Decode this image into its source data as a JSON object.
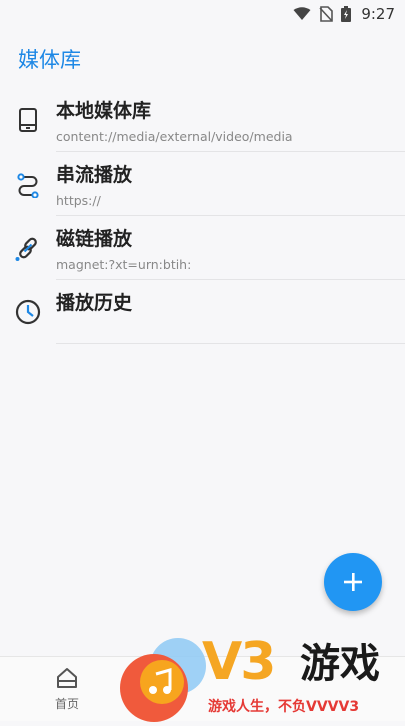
{
  "status_bar": {
    "time": "9:27"
  },
  "app_title": "媒体库",
  "items": [
    {
      "title": "本地媒体库",
      "subtitle": "content://media/external/video/media",
      "icon": "tablet-icon"
    },
    {
      "title": "串流播放",
      "subtitle": "https://",
      "icon": "stream-icon"
    },
    {
      "title": "磁链播放",
      "subtitle": "magnet:?xt=urn:btih:",
      "icon": "link-icon"
    },
    {
      "title": "播放历史",
      "subtitle": "",
      "icon": "clock-icon"
    }
  ],
  "fab": {
    "icon": "plus-icon"
  },
  "bottom_nav": {
    "home_label": "首页"
  },
  "watermark": {
    "brand": "V3",
    "brand_suffix": "游戏",
    "slogan": "游戏人生，不负VVVV3"
  },
  "colors": {
    "accent": "#1e88e5",
    "fab": "#2196f3",
    "watermark_orange": "#f5a623",
    "watermark_red": "#e53935"
  }
}
